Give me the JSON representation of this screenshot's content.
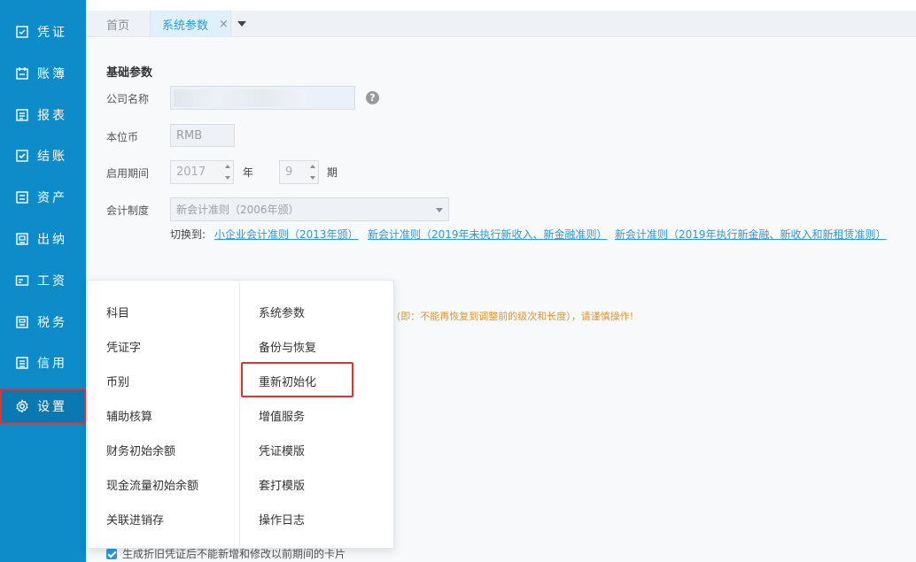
{
  "sidebar": {
    "items": [
      {
        "label": "凭证",
        "icon": "voucher-icon"
      },
      {
        "label": "账簿",
        "icon": "ledger-icon"
      },
      {
        "label": "报表",
        "icon": "report-icon"
      },
      {
        "label": "结账",
        "icon": "checkout-icon"
      },
      {
        "label": "资产",
        "icon": "asset-icon"
      },
      {
        "label": "出纳",
        "icon": "cashier-icon"
      },
      {
        "label": "工资",
        "icon": "salary-icon"
      },
      {
        "label": "税务",
        "icon": "tax-icon"
      },
      {
        "label": "信用",
        "icon": "credit-icon"
      },
      {
        "label": "设置",
        "icon": "gear-icon"
      }
    ]
  },
  "tabs": {
    "home": "首页",
    "active": "系统参数",
    "close": "×"
  },
  "form": {
    "section_title": "基础参数",
    "company_label": "公司名称",
    "company_value": "",
    "help": "?",
    "currency_label": "本位币",
    "currency_value": "RMB",
    "period_label": "启用期间",
    "year_value": "2017",
    "year_unit": "年",
    "period_value": "9",
    "period_unit": "期",
    "standard_label": "会计制度",
    "standard_value": "新会计准则（2006年颁）",
    "switch_label": "切换到:",
    "switch_links": [
      "小企业会计准则（2013年颁）",
      "新会计准则（2019年未执行新收入、新金融准则）",
      "新会计准则（2019年执行新金融、新收入和新租赁准则）"
    ],
    "warning": "(即：不能再恢复到调整前的级次和长度），请谨慎操作!",
    "bottom_check": "生成折旧凭证后不能新增和修改以前期间的卡片"
  },
  "menu": {
    "left": [
      "科目",
      "凭证字",
      "币别",
      "辅助核算",
      "财务初始余额",
      "现金流量初始余额",
      "关联进销存"
    ],
    "right": [
      "系统参数",
      "备份与恢复",
      "重新初始化",
      "增值服务",
      "凭证模版",
      "套打模版",
      "操作日志"
    ]
  },
  "colors": {
    "sidebar": "#0e8bc9",
    "accent": "#2a9bd8",
    "highlight": "#e8312a",
    "warning": "#e0952c"
  }
}
